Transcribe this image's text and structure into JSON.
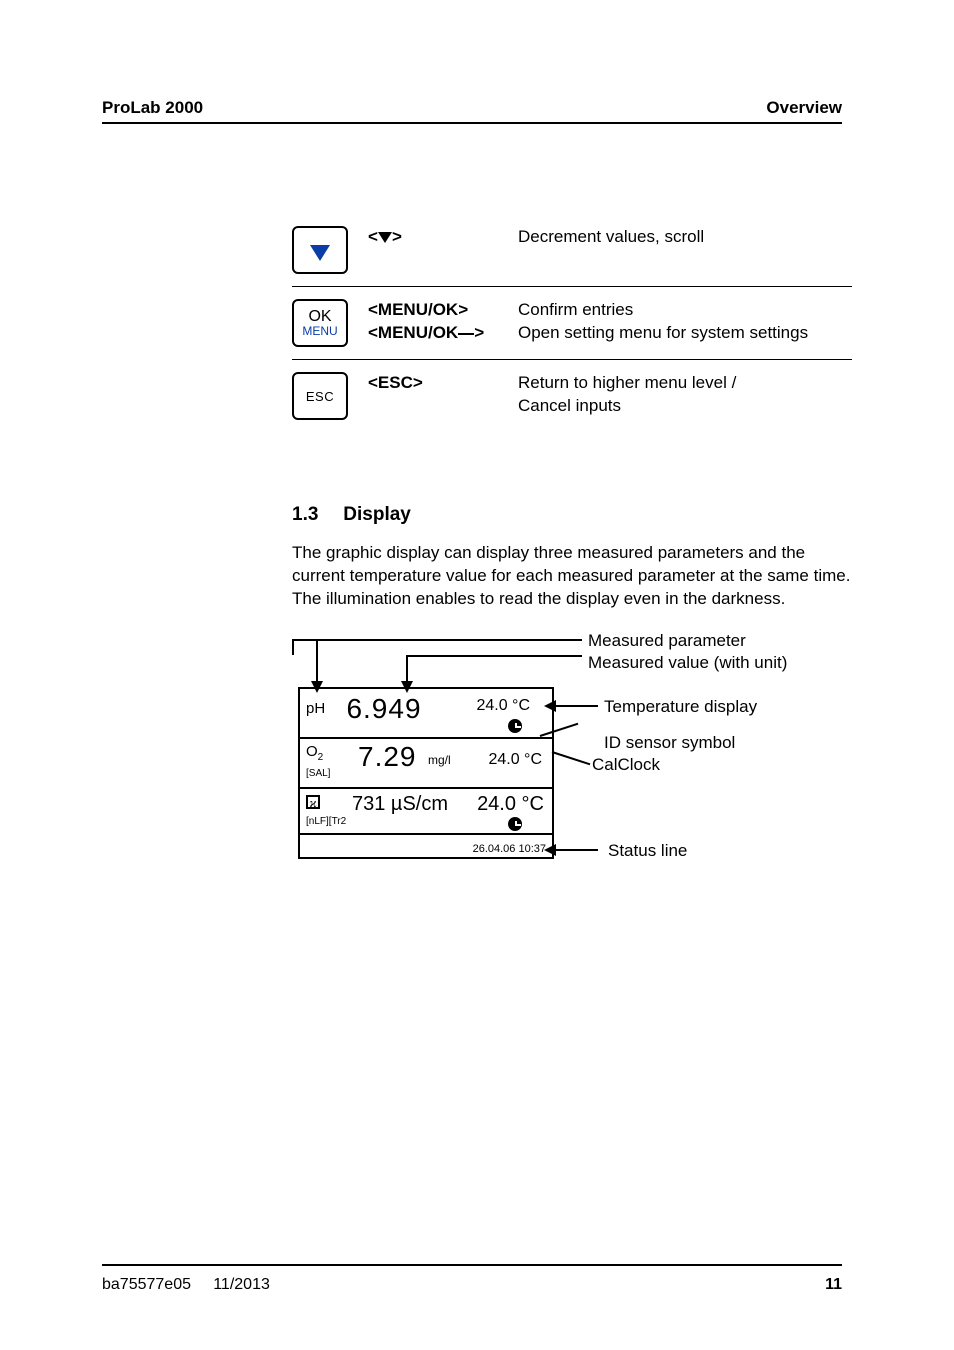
{
  "header": {
    "left": "ProLab 2000",
    "right": "Overview"
  },
  "keys": {
    "down": {
      "symbol_pre": "<",
      "symbol_post": ">",
      "desc": "Decrement values, scroll"
    },
    "menuok": {
      "line1": "<MENU/OK>",
      "line2_pre": "<MENU/OK",
      "line2_post": ">",
      "desc_line1": "Confirm entries",
      "desc_line2": "Open setting menu for system settings",
      "cap_top": "OK",
      "cap_bottom": "MENU"
    },
    "esc": {
      "label": "<ESC>",
      "desc_line1": "Return to higher menu level /",
      "desc_line2": "Cancel inputs",
      "cap": "ESC"
    }
  },
  "section": {
    "number": "1.3",
    "title": "Display",
    "body": "The graphic display can display three measured parameters and the current temperature value for each measured parameter at the same time. The illumination enables to read the display even in the darkness."
  },
  "lcd": {
    "row1": {
      "label": "pH",
      "value": "6.949",
      "temp": "24.0 °C"
    },
    "row2": {
      "label_pre": "O",
      "label_sub": "2",
      "tag": "[SAL]",
      "value": "7.29",
      "unit": "mg/l",
      "temp": "24.0 °C"
    },
    "row3": {
      "tag": "[nLF][Tr2",
      "value": "731 µS/cm",
      "temp": "24.0 °C",
      "cal": "ϰ"
    },
    "status": "26.04.06 10:37"
  },
  "annotations": {
    "measured_param": "Measured parameter",
    "measured_value": "Measured value (with unit)",
    "temp_display": "Temperature display",
    "id_sensor": "ID sensor symbol",
    "calclock": "CalClock",
    "status_line": "Status line"
  },
  "footer": {
    "doc": "ba75577e05",
    "date": "11/2013",
    "page": "11"
  }
}
